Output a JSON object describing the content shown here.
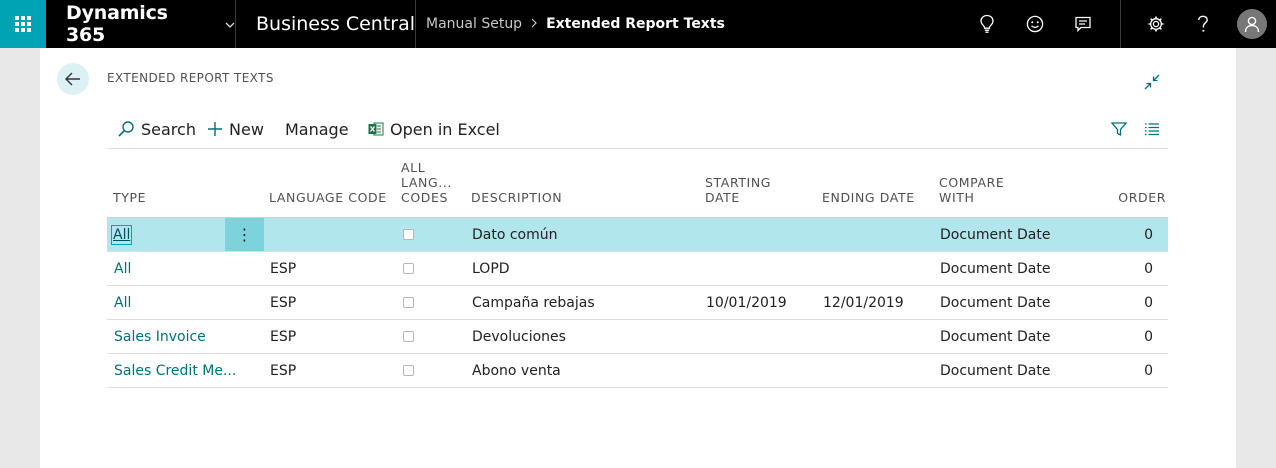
{
  "topbar": {
    "product": "Dynamics 365",
    "app": "Business Central",
    "breadcrumb": [
      "Manual Setup",
      "Extended Report Texts"
    ],
    "icons": [
      "lightbulb-icon",
      "smiley-icon",
      "chat-icon",
      "settings-icon",
      "help-icon",
      "user-avatar-icon"
    ]
  },
  "page": {
    "title": "EXTENDED REPORT TEXTS"
  },
  "actions": {
    "search": "Search",
    "new": "New",
    "manage": "Manage",
    "excel": "Open in Excel"
  },
  "columns": {
    "type": "TYPE",
    "language_code": "LANGUAGE CODE",
    "all_lang_1": "ALL",
    "all_lang_2": "LANG...",
    "all_lang_3": "CODES",
    "description": "DESCRIPTION",
    "starting_1": "STARTING",
    "starting_2": "DATE",
    "ending": "ENDING DATE",
    "compare_1": "COMPARE",
    "compare_2": "WITH",
    "order": "ORDER"
  },
  "rows": [
    {
      "type": "All",
      "language_code": "",
      "all_language_codes": false,
      "description": "Dato común",
      "starting_date": "",
      "ending_date": "",
      "compare_with": "Document Date",
      "order": "0"
    },
    {
      "type": "All",
      "language_code": "ESP",
      "all_language_codes": false,
      "description": "LOPD",
      "starting_date": "",
      "ending_date": "",
      "compare_with": "Document Date",
      "order": "0"
    },
    {
      "type": "All",
      "language_code": "ESP",
      "all_language_codes": false,
      "description": "Campaña rebajas",
      "starting_date": "10/01/2019",
      "ending_date": "12/01/2019",
      "compare_with": "Document Date",
      "order": "0"
    },
    {
      "type": "Sales Invoice",
      "language_code": "ESP",
      "all_language_codes": false,
      "description": "Devoluciones",
      "starting_date": "",
      "ending_date": "",
      "compare_with": "Document Date",
      "order": "0"
    },
    {
      "type": "Sales Credit Me...",
      "language_code": "ESP",
      "all_language_codes": false,
      "description": "Abono venta",
      "starting_date": "",
      "ending_date": "",
      "compare_with": "Document Date",
      "order": "0"
    }
  ],
  "colors": {
    "accent": "#00a3b4",
    "selected_row": "#b1e7ec",
    "link": "#00707a",
    "excel_green": "#1e7145"
  }
}
